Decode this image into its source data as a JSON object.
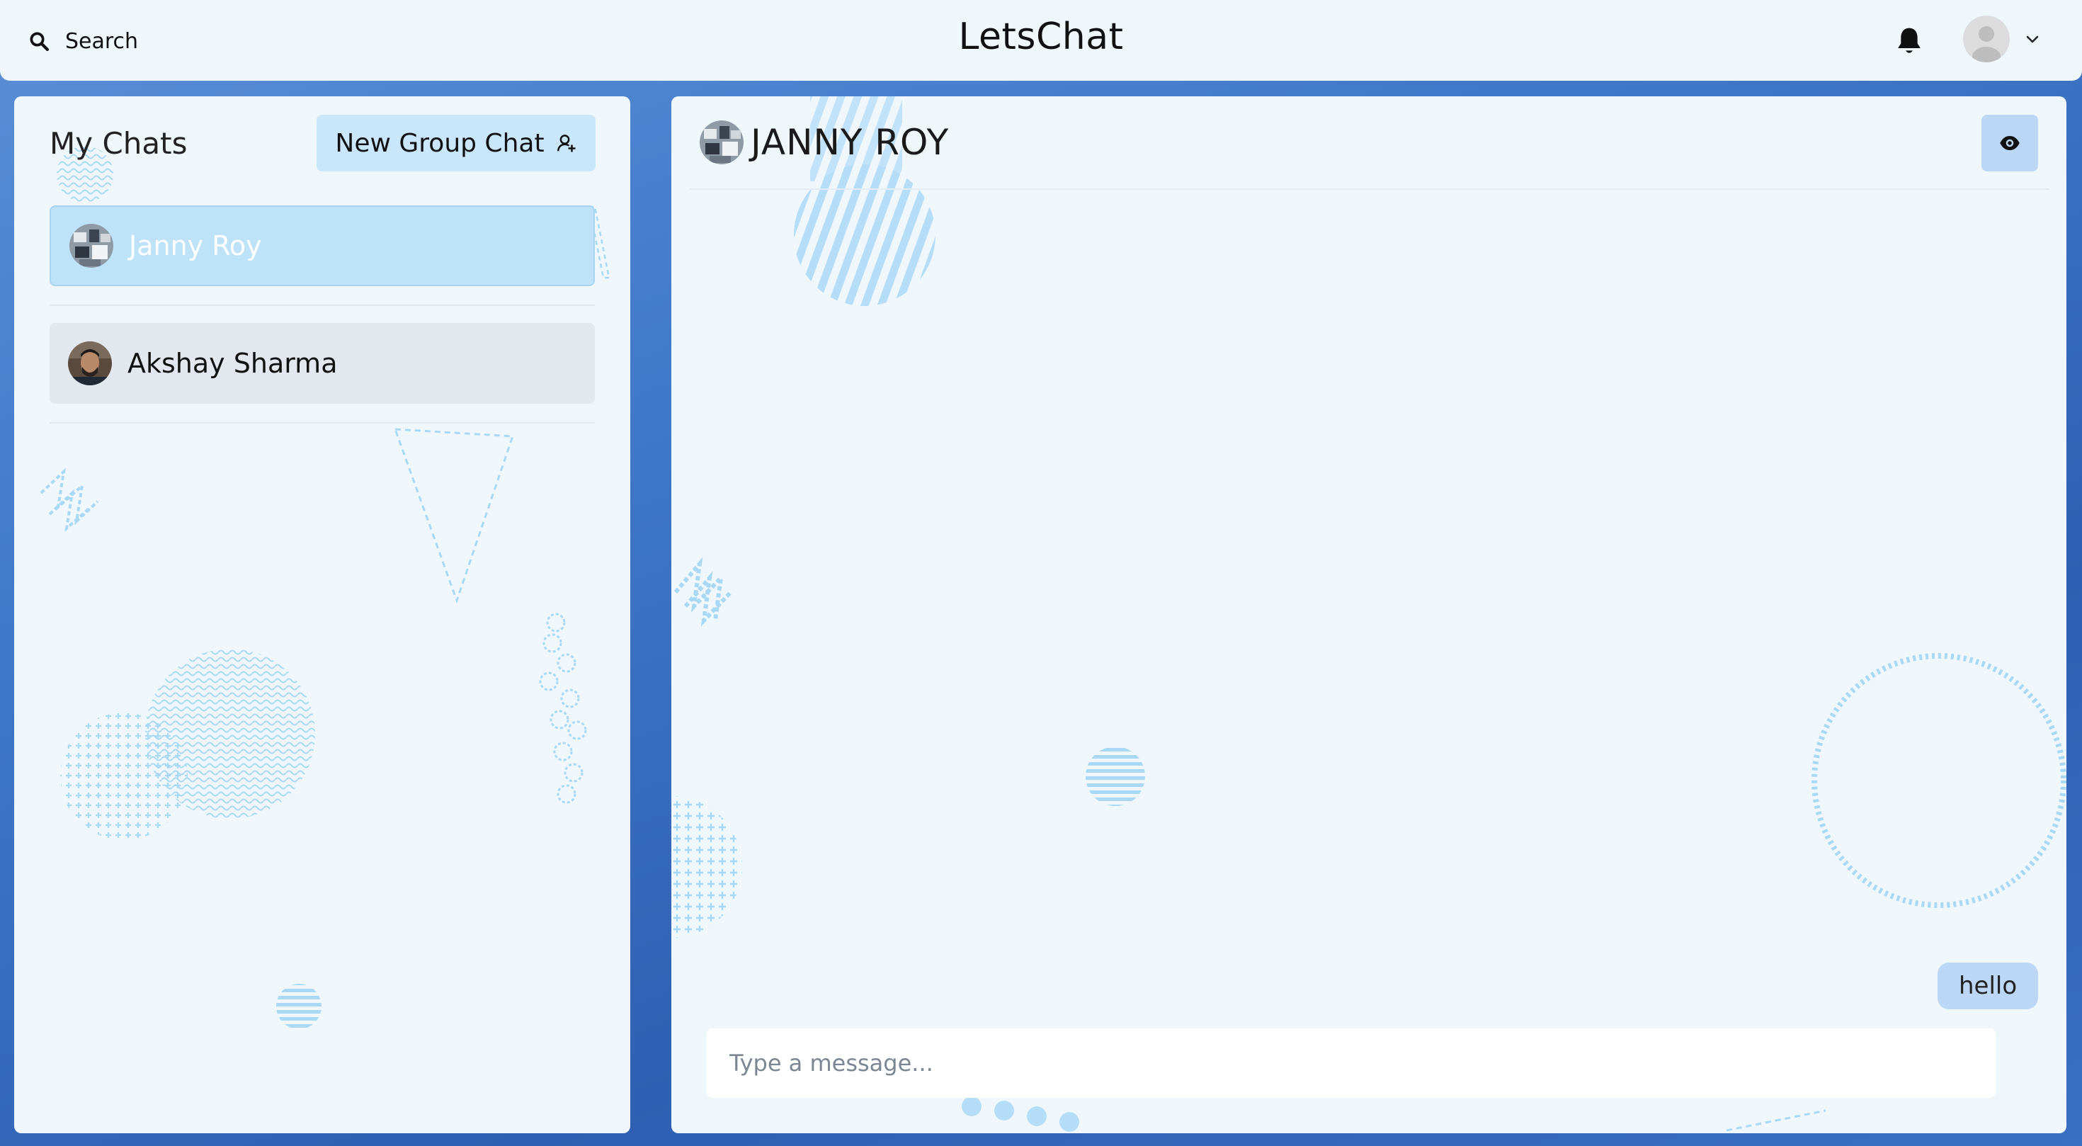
{
  "topbar": {
    "search_label": "Search",
    "app_title": "LetsChat"
  },
  "sidebar": {
    "title": "My Chats",
    "new_group_label": "New Group Chat",
    "chats": [
      {
        "name": "Janny Roy",
        "selected": true
      },
      {
        "name": "Akshay Sharma",
        "selected": false
      }
    ]
  },
  "chat": {
    "header_name": "JANNY ROY",
    "messages": [
      {
        "text": "hello",
        "from_me": true
      }
    ],
    "input_placeholder": "Type a message..."
  },
  "colors": {
    "page_background": "#3f78c9",
    "panel": "#eff7fb",
    "selected_chat": "#bee3f8",
    "message_bubble": "#bcd6f6",
    "new_group_button": "#c9e6fb"
  },
  "icons": {
    "search": "search-icon",
    "bell": "bell-icon",
    "profile": "user-avatar-icon",
    "dropdown": "chevron-down-icon",
    "new_group": "add-group-icon",
    "view_profile": "eye-icon"
  }
}
